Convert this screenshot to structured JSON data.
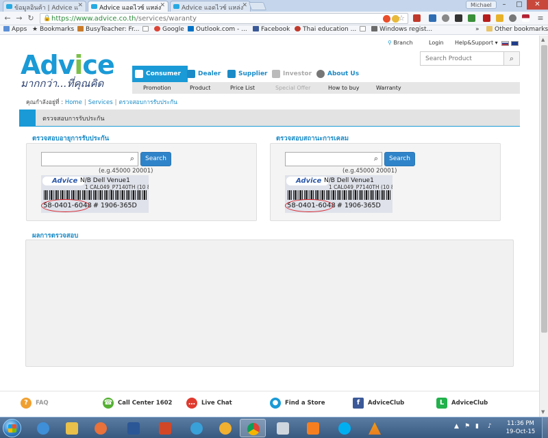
{
  "browser": {
    "tabs": [
      {
        "label": "ข้อมูลอินค้า | Advice แ",
        "active": false
      },
      {
        "label": "Advice แอดไวซ์ แหล่ง",
        "active": true
      },
      {
        "label": "Advice แอดไวซ์ แหล่ง",
        "active": false
      }
    ],
    "user": "Michael",
    "url_host": "https://www.advice.co.th",
    "url_path": "/services/waranty",
    "bookmarks": [
      {
        "label": "Apps",
        "color": "#5b8fd6"
      },
      {
        "label": "Bookmarks",
        "color": "#555555"
      },
      {
        "label": "BusyTeacher: Fr...",
        "color": "#c97b2a"
      },
      {
        "label": "",
        "color": "#999999"
      },
      {
        "label": "Google",
        "color": "#db4437"
      },
      {
        "label": "Outlook.com - ...",
        "color": "#0072c6"
      },
      {
        "label": "Facebook",
        "color": "#3b5998"
      },
      {
        "label": "Thai education ...",
        "color": "#c0392b"
      },
      {
        "label": "",
        "color": "#999999"
      },
      {
        "label": "Windows regist...",
        "color": "#6b6b6b"
      }
    ],
    "bookmarks_more": "»",
    "other_bookmarks": "Other bookmarks"
  },
  "site": {
    "logo_word_a": "Adv",
    "logo_word_b": "i",
    "logo_word_c": "ce",
    "slogan": "มากกว่า...ที่คุณคิด",
    "top_links": {
      "branch": "Branch",
      "login": "Login",
      "help": "Help&Support ▾"
    },
    "search_placeholder": "Search Product",
    "main_menu": [
      {
        "label": "Consumer",
        "state": "active"
      },
      {
        "label": "Dealer",
        "state": "normal"
      },
      {
        "label": "Supplier",
        "state": "normal"
      },
      {
        "label": "Investor",
        "state": "disabled"
      },
      {
        "label": "About Us",
        "state": "normal"
      }
    ],
    "sub_menu": [
      {
        "label": "Promotion",
        "state": "normal"
      },
      {
        "label": "Product",
        "state": "normal"
      },
      {
        "label": "Price List",
        "state": "normal"
      },
      {
        "label": "Special Offer",
        "state": "disabled"
      },
      {
        "label": "How to buy",
        "state": "normal"
      },
      {
        "label": "Warranty",
        "state": "normal"
      }
    ],
    "breadcrumb": {
      "prefix": "คุณกำลังอยู่ที่ :",
      "home": "Home",
      "services": "Services",
      "current": "ตรวจสอบการรับประกัน"
    },
    "page_title": "ตรวจสอบการรับประกัน",
    "panels": [
      {
        "heading": "ตรวจสอบอายุการรับประกัน",
        "input_value": "",
        "button": "Search",
        "example": "(e.g.45000 20001)"
      },
      {
        "heading": "ตรวจสอบสถานะการเคลม",
        "input_value": "",
        "button": "Search",
        "example": "(e.g.45000 20001)"
      }
    ],
    "sticker": {
      "brand": "Advice",
      "line1": "N/B Dell Venue1",
      "line2": "1 CAL049_P7140TH (10 8",
      "serial": "58-0401-6048",
      "serial_tail": "# 1906-365D"
    },
    "result_heading": "ผลการตรวจสอบ",
    "footer": [
      {
        "label": "FAQ",
        "icon": "?",
        "color": "#f0a030",
        "muted": true
      },
      {
        "label": "Call Center 1602",
        "icon": "☎",
        "color": "#55b034",
        "muted": false
      },
      {
        "label": "Live Chat",
        "icon": "…",
        "color": "#e03a2f",
        "muted": false
      },
      {
        "label": "Find a Store",
        "icon": "●",
        "color": "#1a9ad6",
        "muted": false
      },
      {
        "label": "AdviceClub",
        "icon": "f",
        "color": "#3b5998",
        "muted": false
      },
      {
        "label": "AdviceClub",
        "icon": "L",
        "color": "#22b14c",
        "muted": false
      }
    ]
  },
  "taskbar": {
    "time": "11:36 PM",
    "date": "19-Oct-15",
    "apps": [
      "#3e8fd8",
      "#e8c04a",
      "#e9713a",
      "#2b5797",
      "#d24726",
      "#3aa0d8",
      "#f0b030",
      "#e0e0e0",
      "#cfd6de",
      "#f57f20",
      "#00aff0",
      "#f39c12"
    ]
  }
}
